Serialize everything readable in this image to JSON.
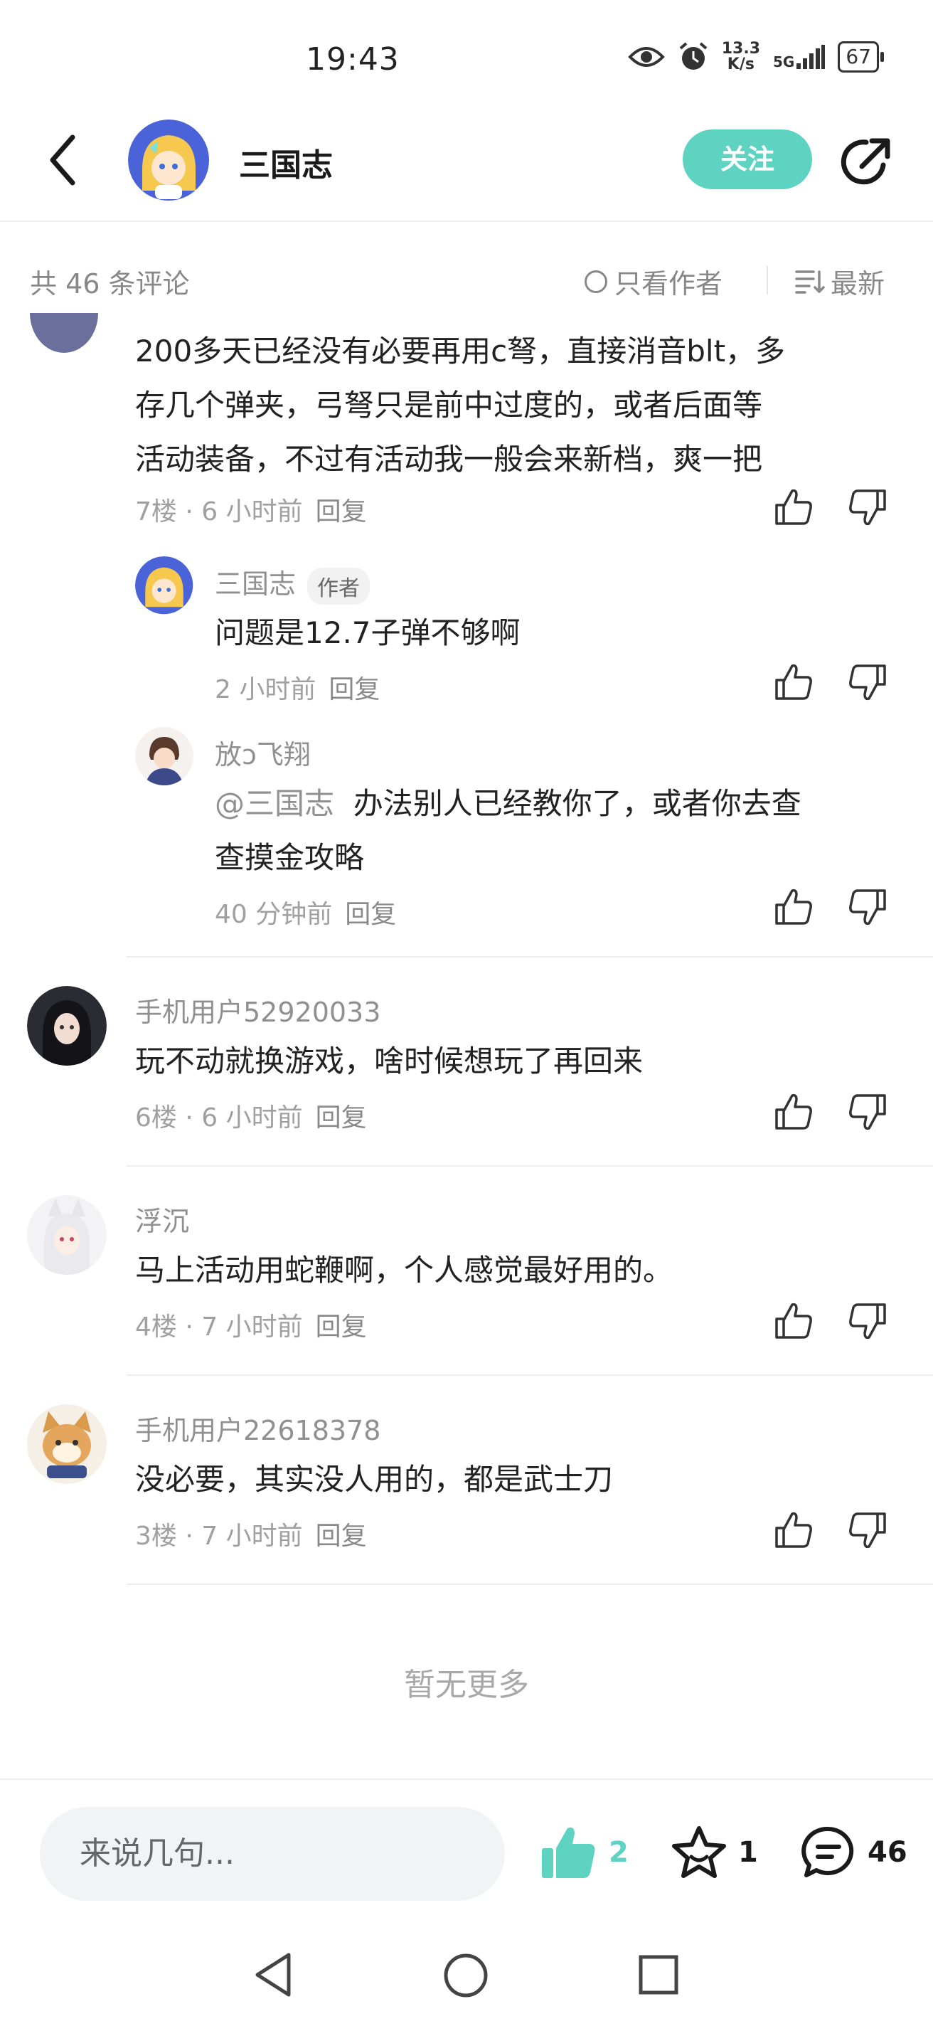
{
  "status_bar": {
    "time": "19:43",
    "net_speed_top": "13.3",
    "net_speed_bottom": "K/s",
    "signal": "5G",
    "battery": "67"
  },
  "header": {
    "title": "三国志",
    "follow_label": "关注"
  },
  "filter": {
    "count_label": "共 46 条评论",
    "only_author_label": "只看作者",
    "sort_label": "最新"
  },
  "comments": [
    {
      "text_lines": [
        "200多天已经没有必要再用c弩，直接消音blt，多",
        "存几个弹夹，弓弩只是前中过度的，或者后面等",
        "活动装备，不过有活动我一般会来新档，爽一把"
      ],
      "floor": "7楼",
      "time": "6 小时前",
      "reply_label": "回复",
      "replies": [
        {
          "name": "三国志",
          "badge": "作者",
          "text": "问题是12.7子弹不够啊",
          "time": "2 小时前",
          "reply_label": "回复"
        },
        {
          "name": "放ↄ飞翔",
          "mention": "@三国志",
          "text_line1": "办法别人已经教你了，或者你去查",
          "text_line2": "查摸金攻略",
          "time": "40 分钟前",
          "reply_label": "回复"
        }
      ]
    },
    {
      "name": "手机用户52920033",
      "text": "玩不动就换游戏，啥时候想玩了再回来",
      "floor": "6楼",
      "time": "6 小时前",
      "reply_label": "回复"
    },
    {
      "name": "浮沉",
      "text": "马上活动用蛇鞭啊，个人感觉最好用的。",
      "floor": "4楼",
      "time": "7 小时前",
      "reply_label": "回复"
    },
    {
      "name": "手机用户22618378",
      "text": "没必要，其实没人用的，都是武士刀",
      "floor": "3楼",
      "time": "7 小时前",
      "reply_label": "回复"
    }
  ],
  "no_more_label": "暂无更多",
  "bottom_bar": {
    "input_placeholder": "来说几句...",
    "like_count": "2",
    "favorite_count": "1",
    "comment_count": "46"
  },
  "colors": {
    "accent": "#5ed3c2",
    "text_primary": "#222222",
    "text_secondary": "#a0a0a0",
    "divider": "#eeeeee"
  }
}
